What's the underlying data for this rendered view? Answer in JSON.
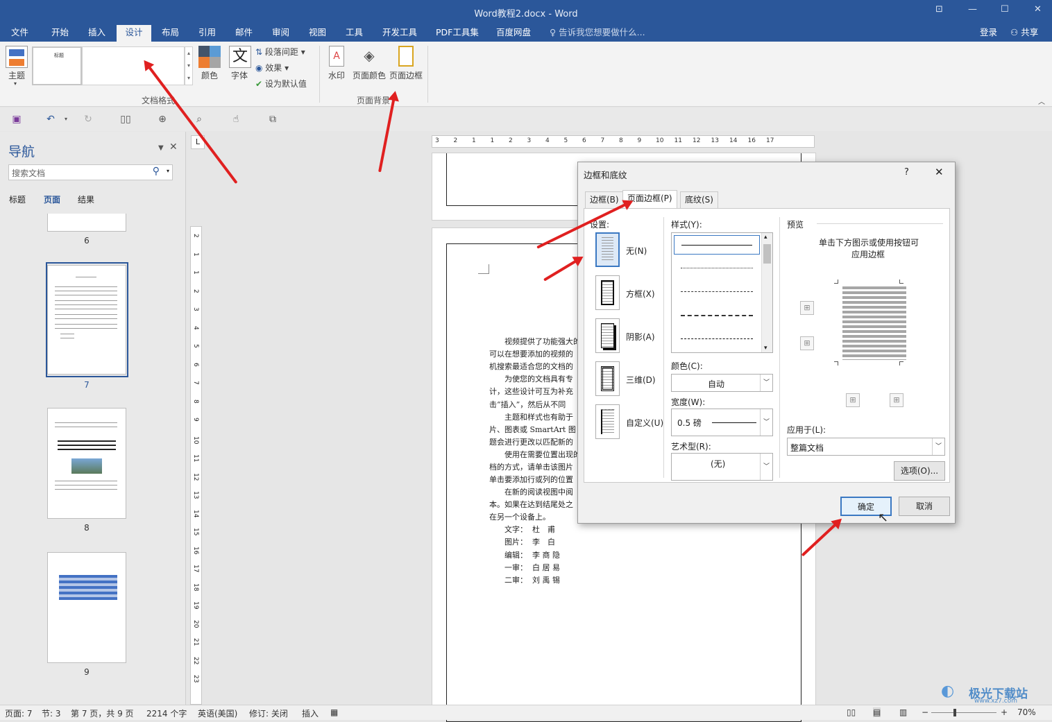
{
  "window": {
    "title": "Word教程2.docx - Word",
    "controls": [
      "⊡",
      "—",
      "☐",
      "✕"
    ]
  },
  "menu": {
    "tabs": [
      "文件",
      "开始",
      "插入",
      "设计",
      "布局",
      "引用",
      "邮件",
      "审阅",
      "视图",
      "工具",
      "开发工具",
      "PDF工具集",
      "百度网盘"
    ],
    "active": "设计",
    "tell_me": "告诉我您想要做什么...",
    "login": "登录",
    "share": "共享"
  },
  "ribbon": {
    "theme_label": "主题",
    "style_preview_label": "标题",
    "colors_label": "颜色",
    "fonts_label": "字体",
    "fonts_glyph": "文",
    "paragraph_spacing_label": "段落间距",
    "effects_label": "效果",
    "set_default_label": "设为默认值",
    "group_doc_format": "文档格式",
    "watermark_label": "水印",
    "page_color_label": "页面颜色",
    "page_border_label": "页面边框",
    "group_page_background": "页面背景"
  },
  "nav": {
    "title": "导航",
    "search_placeholder": "搜索文档",
    "tabs": [
      "标题",
      "页面",
      "结果"
    ],
    "active_tab": "页面",
    "pages": [
      "6",
      "7",
      "8",
      "9"
    ],
    "selected_page": "7"
  },
  "document": {
    "ruler_numbers": [
      "3",
      "2",
      "1",
      "1",
      "2",
      "3",
      "4",
      "5",
      "6",
      "7",
      "8",
      "9",
      "10",
      "11",
      "12",
      "13",
      "14",
      "16",
      "17"
    ],
    "vruler_numbers": [
      "2",
      "1",
      "1",
      "2",
      "3",
      "4",
      "5",
      "6",
      "7",
      "8",
      "9",
      "10",
      "11",
      "12",
      "13",
      "14",
      "15",
      "16",
      "17",
      "18",
      "19",
      "20",
      "21",
      "22",
      "23"
    ],
    "paragraph_lines": [
      "视频提供了功能强大的",
      "可以在想要添加的视频的",
      "机搜索最适合您的文档的",
      "为使您的文档具有专",
      "计，这些设计可互为补充",
      "击“插入”，然后从不同",
      "主题和样式也有助于",
      "片、图表或 SmartArt 图",
      "题会进行更改以匹配新的",
      "使用在需要位置出现的",
      "档的方式，请单击该图片",
      "单击要添加行或列的位置",
      "在新的阅读视图中阅",
      "本。如果在达到结尾处之",
      "在另一个设备上。"
    ],
    "credits": [
      {
        "role": "文字：",
        "name": "杜　甫"
      },
      {
        "role": "图片：",
        "name": "李　白"
      },
      {
        "role": "编辑：",
        "name": "李 商 隐"
      },
      {
        "role": "一审：",
        "name": "白 居 易"
      },
      {
        "role": "二审：",
        "name": "刘 禹 锡"
      }
    ]
  },
  "dialog": {
    "title": "边框和底纹",
    "help": "?",
    "close": "✕",
    "tabs": [
      "边框(B)",
      "页面边框(P)",
      "底纹(S)"
    ],
    "active_tab": "页面边框(P)",
    "settings_label": "设置:",
    "settings": [
      "无(N)",
      "方框(X)",
      "阴影(A)",
      "三维(D)",
      "自定义(U)"
    ],
    "selected_setting": "无(N)",
    "style_label": "样式(Y):",
    "color_label": "颜色(C):",
    "color_value": "自动",
    "width_label": "宽度(W):",
    "width_value": "0.5 磅",
    "art_label": "艺术型(R):",
    "art_value": "(无)",
    "preview_label": "预览",
    "preview_hint_1": "单击下方图示或使用按钮可",
    "preview_hint_2": "应用边框",
    "apply_to_label": "应用于(L):",
    "apply_to_value": "整篇文档",
    "options_button": "选项(O)...",
    "ok_button": "确定",
    "cancel_button": "取消"
  },
  "status": {
    "page": "页面: 7",
    "section": "节: 3",
    "page_of": "第 7 页，共 9 页",
    "words": "2214 个字",
    "language": "英语(美国)",
    "track": "修订: 关闭",
    "insert": "插入",
    "zoom": "70%"
  },
  "watermark_text": "极光下载站",
  "watermark_url": "www.xz7.com",
  "colors": {
    "word_blue": "#2b579a",
    "annotation_red": "#e02020",
    "selection_blue": "#3a78c2"
  }
}
